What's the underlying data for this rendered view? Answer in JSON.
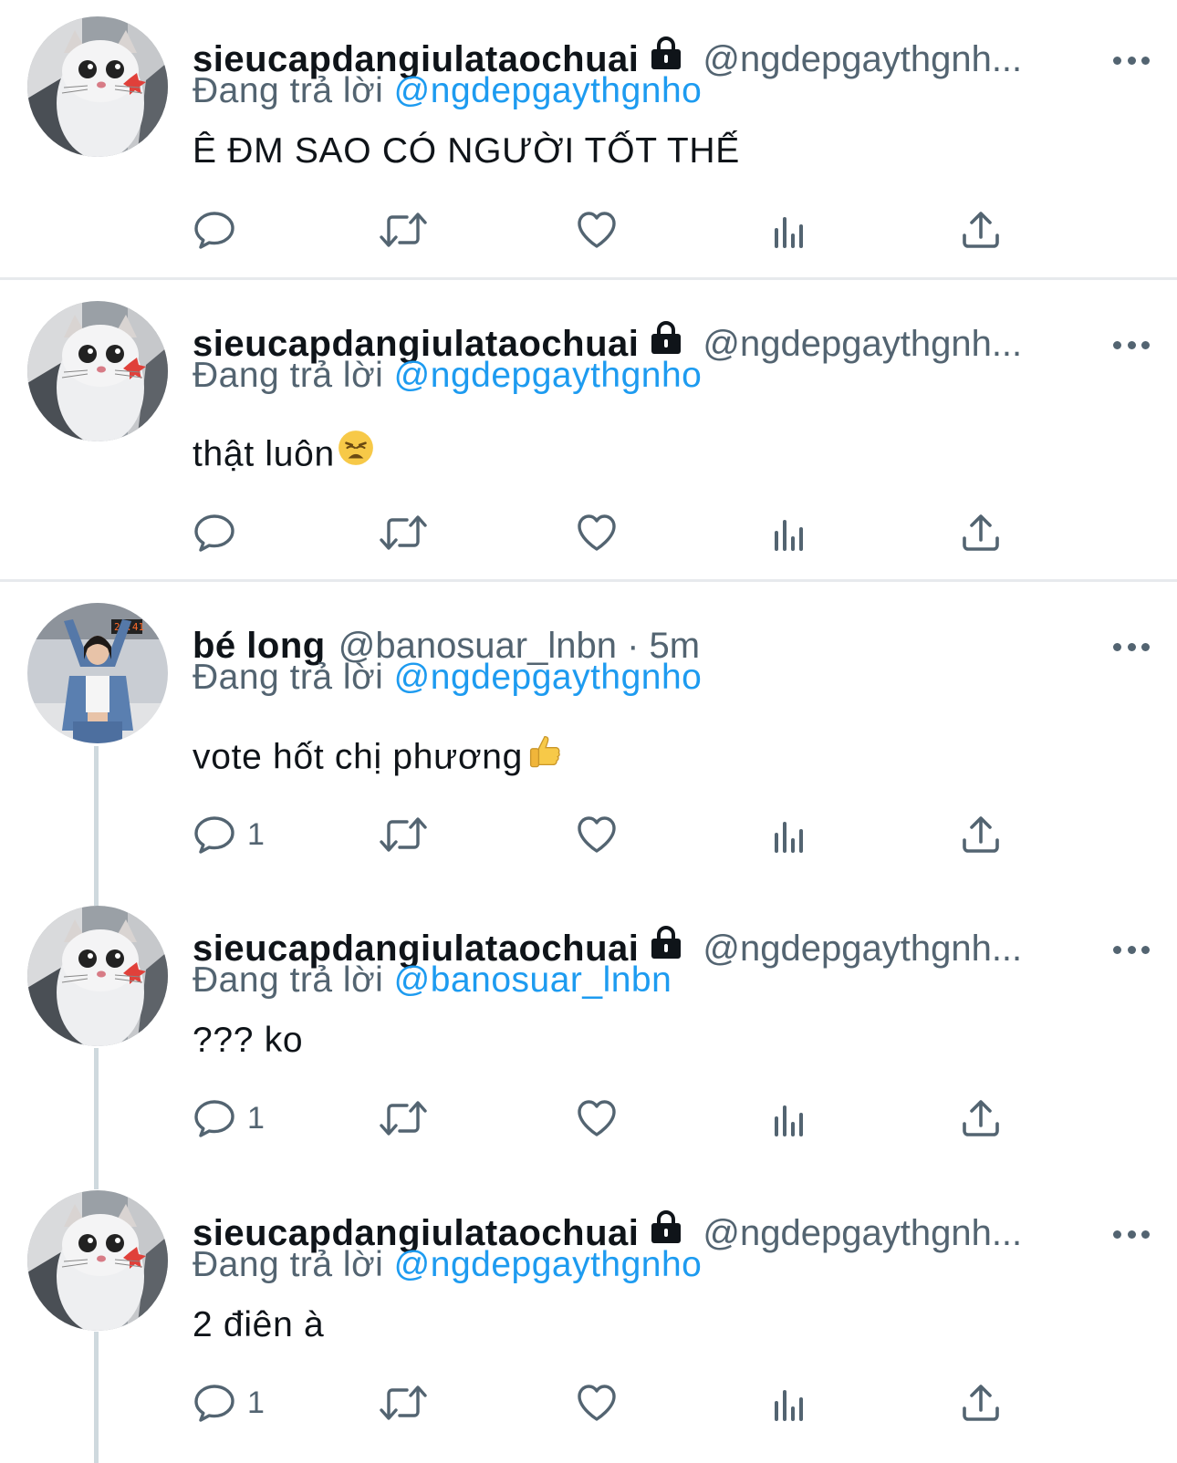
{
  "colors": {
    "accent": "#1d9bf0",
    "secondary_text": "#536471",
    "divider": "#e7eaed",
    "thread_line": "#cfd9de"
  },
  "icons": [
    "reply-icon",
    "retweet-icon",
    "like-icon",
    "views-icon",
    "share-icon",
    "lock-icon",
    "more-icon"
  ],
  "tweets": [
    {
      "name": "sieucapdangiulataochuai",
      "protected": true,
      "handle": "@ngdepgaythgnh...",
      "meta": "",
      "replying_label": "Đang trả lời",
      "replying_to": "@ngdepgaythgnho",
      "text": "Ê ĐM SAO CÓ NGƯỜI TỐT THẾ",
      "emoji": "",
      "reply_count": ""
    },
    {
      "name": "sieucapdangiulataochuai",
      "protected": true,
      "handle": "@ngdepgaythgnh...",
      "meta": "",
      "replying_label": "Đang trả lời",
      "replying_to": "@ngdepgaythgnho",
      "text": "thật luôn",
      "emoji": "weary-face",
      "reply_count": ""
    },
    {
      "name": "bé long",
      "protected": false,
      "handle": "@banosuar_lnbn",
      "meta": " · 5m",
      "replying_label": "Đang trả lời",
      "replying_to": "@ngdepgaythgnho",
      "text": "vote hốt chị phương",
      "emoji": "thumbs-up",
      "reply_count": "1"
    },
    {
      "name": "sieucapdangiulataochuai",
      "protected": true,
      "handle": "@ngdepgaythgnh...",
      "meta": "",
      "replying_label": "Đang trả lời",
      "replying_to": "@banosuar_lnbn",
      "text": "??? ko",
      "emoji": "",
      "reply_count": "1"
    },
    {
      "name": "sieucapdangiulataochuai",
      "protected": true,
      "handle": "@ngdepgaythgnh...",
      "meta": "",
      "replying_label": "Đang trả lời",
      "replying_to": "@ngdepgaythgnho",
      "text": "2 điên à",
      "emoji": "",
      "reply_count": "1"
    }
  ]
}
